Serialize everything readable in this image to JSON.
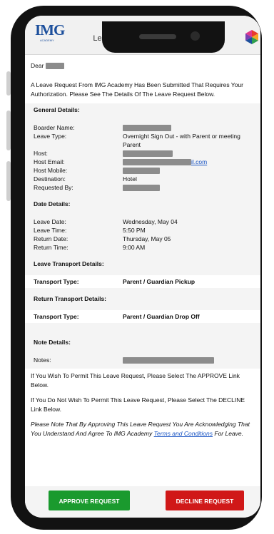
{
  "header": {
    "logo_text": "IMG",
    "logo_sub": "ACADEMY",
    "title": "Leave Authorization Required"
  },
  "greeting": "Dear",
  "intro": "A Leave Request From IMG Academy Has Been Submitted That Requires Your Authorization. Please See The Details Of The Leave Request Below.",
  "general": {
    "title": "General Details:",
    "boarder_label": "Boarder Name:",
    "leave_type_label": "Leave Type:",
    "leave_type_value": "Overnight Sign Out - with Parent or meeting Parent",
    "host_label": "Host:",
    "host_email_label": "Host Email:",
    "host_email_suffix": "il.com",
    "host_mobile_label": "Host Mobile:",
    "destination_label": "Destination:",
    "destination_value": "Hotel",
    "requested_by_label": "Requested By:"
  },
  "dates": {
    "title": "Date Details:",
    "leave_date_label": "Leave Date:",
    "leave_date_value": "Wednesday, May 04",
    "leave_time_label": "Leave Time:",
    "leave_time_value": "5:50 PM",
    "return_date_label": "Return Date:",
    "return_date_value": "Thursday, May 05",
    "return_time_label": "Return Time:",
    "return_time_value": "9:00 AM"
  },
  "leave_transport": {
    "title": "Leave Transport Details:",
    "label": "Transport Type:",
    "value": "Parent / Guardian Pickup"
  },
  "return_transport": {
    "title": "Return Transport Details:",
    "label": "Transport Type:",
    "value": "Parent / Guardian Drop Off"
  },
  "notes": {
    "title": "Note Details:",
    "label": "Notes:"
  },
  "approve_text": "If You Wish To Permit This Leave Request, Please Select The APPROVE Link Below.",
  "decline_text": "If You Do Not Wish To Permit This Leave Request, Please Select The DECLINE Link Below.",
  "disclaimer": {
    "before": "Please Note That By Approving This Leave Request You Are Acknowledging That You Understand And Agree To IMG Academy",
    "link": "Terms and Conditions",
    "after": "For Leave."
  },
  "buttons": {
    "approve": "APPROVE REQUEST",
    "decline": "DECLINE REQUEST"
  },
  "colors": {
    "approve": "#1a9a2e",
    "decline": "#d01818",
    "link": "#1a55c4",
    "logo": "#1c4f9c"
  }
}
